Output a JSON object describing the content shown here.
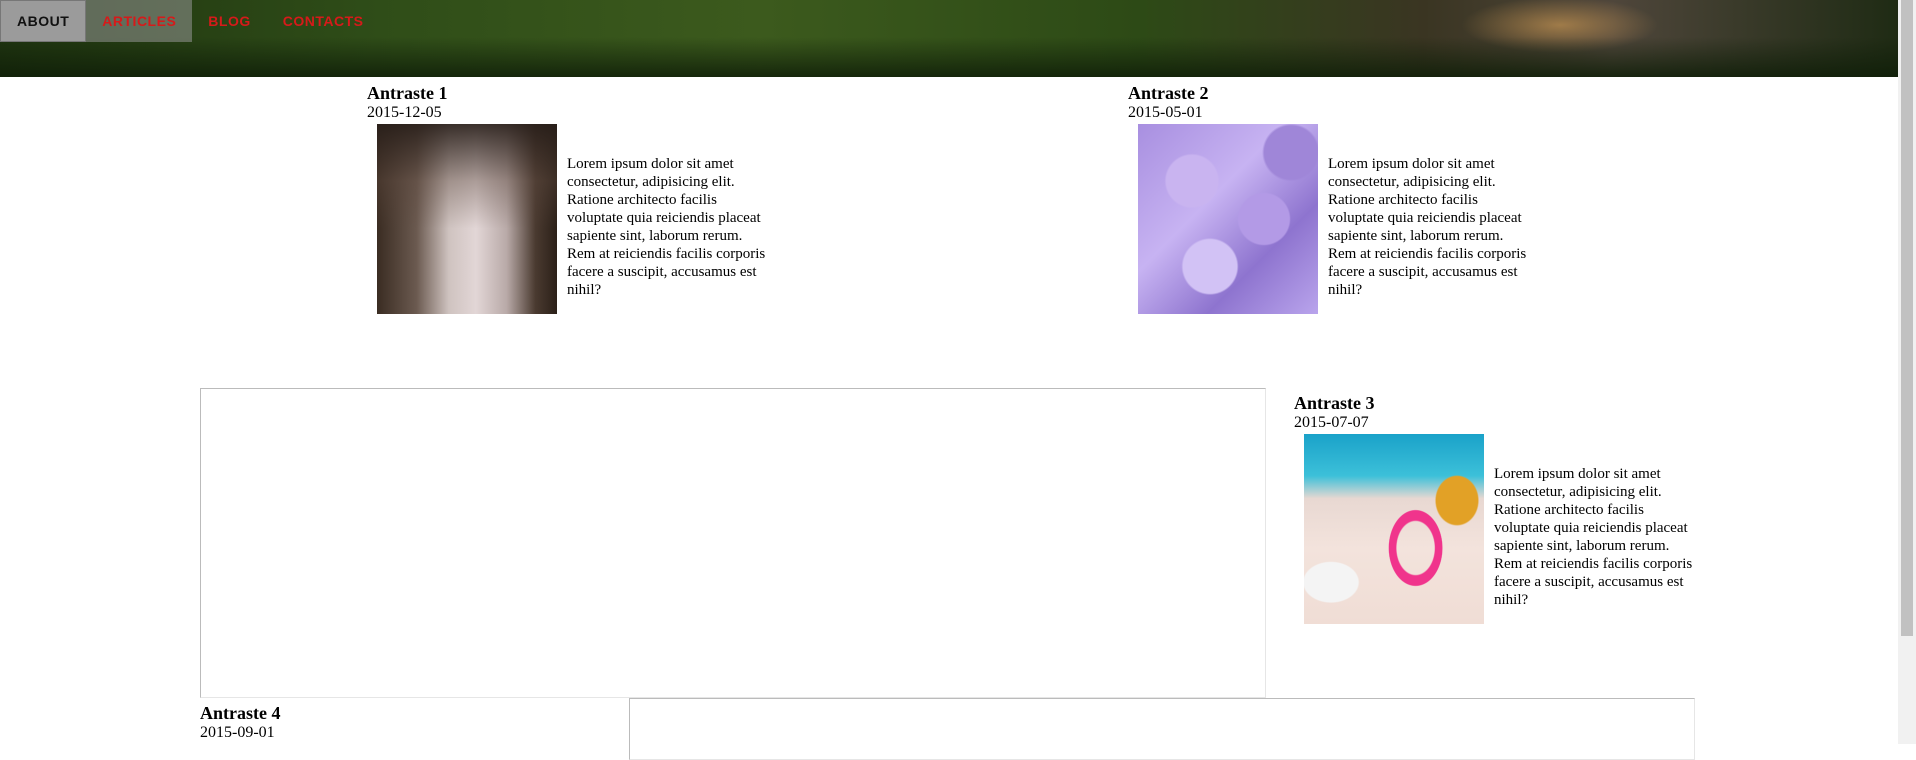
{
  "nav": {
    "items": [
      "ABOUT",
      "ARTICLES",
      "BLOG",
      "CONTACTS"
    ]
  },
  "articles": [
    {
      "title": "Antraste 1",
      "date": "2015-12-05",
      "image": "snowy-bridge-photo",
      "text": "Lorem ipsum dolor sit amet consectetur, adipisicing elit. Ratione architecto facilis voluptate quia reiciendis placeat sapiente sint, laborum rerum. Rem at reiciendis facilis corporis facere a suscipit, accusamus est nihil?"
    },
    {
      "title": "Antraste 2",
      "date": "2015-05-01",
      "image": "crocus-flowers-photo",
      "text": "Lorem ipsum dolor sit amet consectetur, adipisicing elit. Ratione architecto facilis voluptate quia reiciendis placeat sapiente sint, laborum rerum. Rem at reiciendis facilis corporis facere a suscipit, accusamus est nihil?"
    },
    {
      "title": "Antraste 3",
      "date": "2015-07-07",
      "image": "beach-flamingo-photo",
      "text": "Lorem ipsum dolor sit amet consectetur, adipisicing elit. Ratione architecto facilis voluptate quia reiciendis placeat sapiente sint, laborum rerum. Rem at reiciendis facilis corporis facere a suscipit, accusamus est nihil?"
    },
    {
      "title": "Antraste 4",
      "date": "2015-09-01"
    }
  ]
}
